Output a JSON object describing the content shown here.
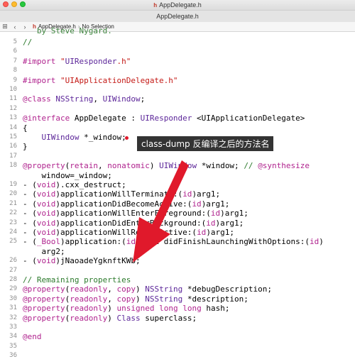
{
  "window": {
    "title": "AppDelegate.h",
    "tab_title": "AppDelegate.h",
    "title_icon": "h"
  },
  "jumpbar": {
    "file_icon": "h",
    "file": "AppDelegate.h",
    "separator": "›",
    "selection": "No Selection"
  },
  "annotation": {
    "text": "class-dump 反编译之后的方法名"
  },
  "colors": {
    "keyword": "#b0238e",
    "string": "#c41a16",
    "comment": "#2c7a2c",
    "type": "#5c2699",
    "annotation_bg": "#333333",
    "arrow": "#e0192b"
  },
  "icons": [
    "grid-icon",
    "back-arrow-icon",
    "forward-arrow-icon",
    "header-file-icon"
  ],
  "code": {
    "partial_top": "   by Steve Nygard.",
    "lines": [
      {
        "n": "5",
        "t": "//"
      },
      {
        "n": "6",
        "t": ""
      },
      {
        "n": "7",
        "t": "#import \"UIResponder.h\""
      },
      {
        "n": "8",
        "t": ""
      },
      {
        "n": "9",
        "t": "#import \"UIApplicationDelegate.h\""
      },
      {
        "n": "10",
        "t": ""
      },
      {
        "n": "11",
        "t": "@class NSString, UIWindow;"
      },
      {
        "n": "12",
        "t": ""
      },
      {
        "n": "13",
        "t": "@interface AppDelegate : UIResponder <UIApplicationDelegate>"
      },
      {
        "n": "14",
        "t": "{"
      },
      {
        "n": "15",
        "t": "    UIWindow *_window;"
      },
      {
        "n": "16",
        "t": "}"
      },
      {
        "n": "17",
        "t": ""
      },
      {
        "n": "18",
        "t": "@property(retain, nonatomic) UIWindow *window; // @synthesize"
      },
      {
        "n": "",
        "t": "    window=_window;"
      },
      {
        "n": "19",
        "t": "- (void).cxx_destruct;"
      },
      {
        "n": "20",
        "t": "- (void)applicationWillTerminate:(id)arg1;"
      },
      {
        "n": "21",
        "t": "- (void)applicationDidBecomeActive:(id)arg1;"
      },
      {
        "n": "22",
        "t": "- (void)applicationWillEnterForeground:(id)arg1;"
      },
      {
        "n": "23",
        "t": "- (void)applicationDidEnterBackground:(id)arg1;"
      },
      {
        "n": "24",
        "t": "- (void)applicationWillResignActive:(id)arg1;"
      },
      {
        "n": "25",
        "t": "- (_Bool)application:(id)arg1 didFinishLaunchingWithOptions:(id)"
      },
      {
        "n": "",
        "t": "    arg2;"
      },
      {
        "n": "26",
        "t": "- (void)jNaoadeYgknftKWb;"
      },
      {
        "n": "27",
        "t": ""
      },
      {
        "n": "28",
        "t": "// Remaining properties"
      },
      {
        "n": "29",
        "t": "@property(readonly, copy) NSString *debugDescription;"
      },
      {
        "n": "30",
        "t": "@property(readonly, copy) NSString *description;"
      },
      {
        "n": "31",
        "t": "@property(readonly) unsigned long long hash;"
      },
      {
        "n": "32",
        "t": "@property(readonly) Class superclass;"
      },
      {
        "n": "33",
        "t": ""
      },
      {
        "n": "34",
        "t": "@end"
      },
      {
        "n": "35",
        "t": ""
      },
      {
        "n": "36",
        "t": ""
      }
    ]
  }
}
